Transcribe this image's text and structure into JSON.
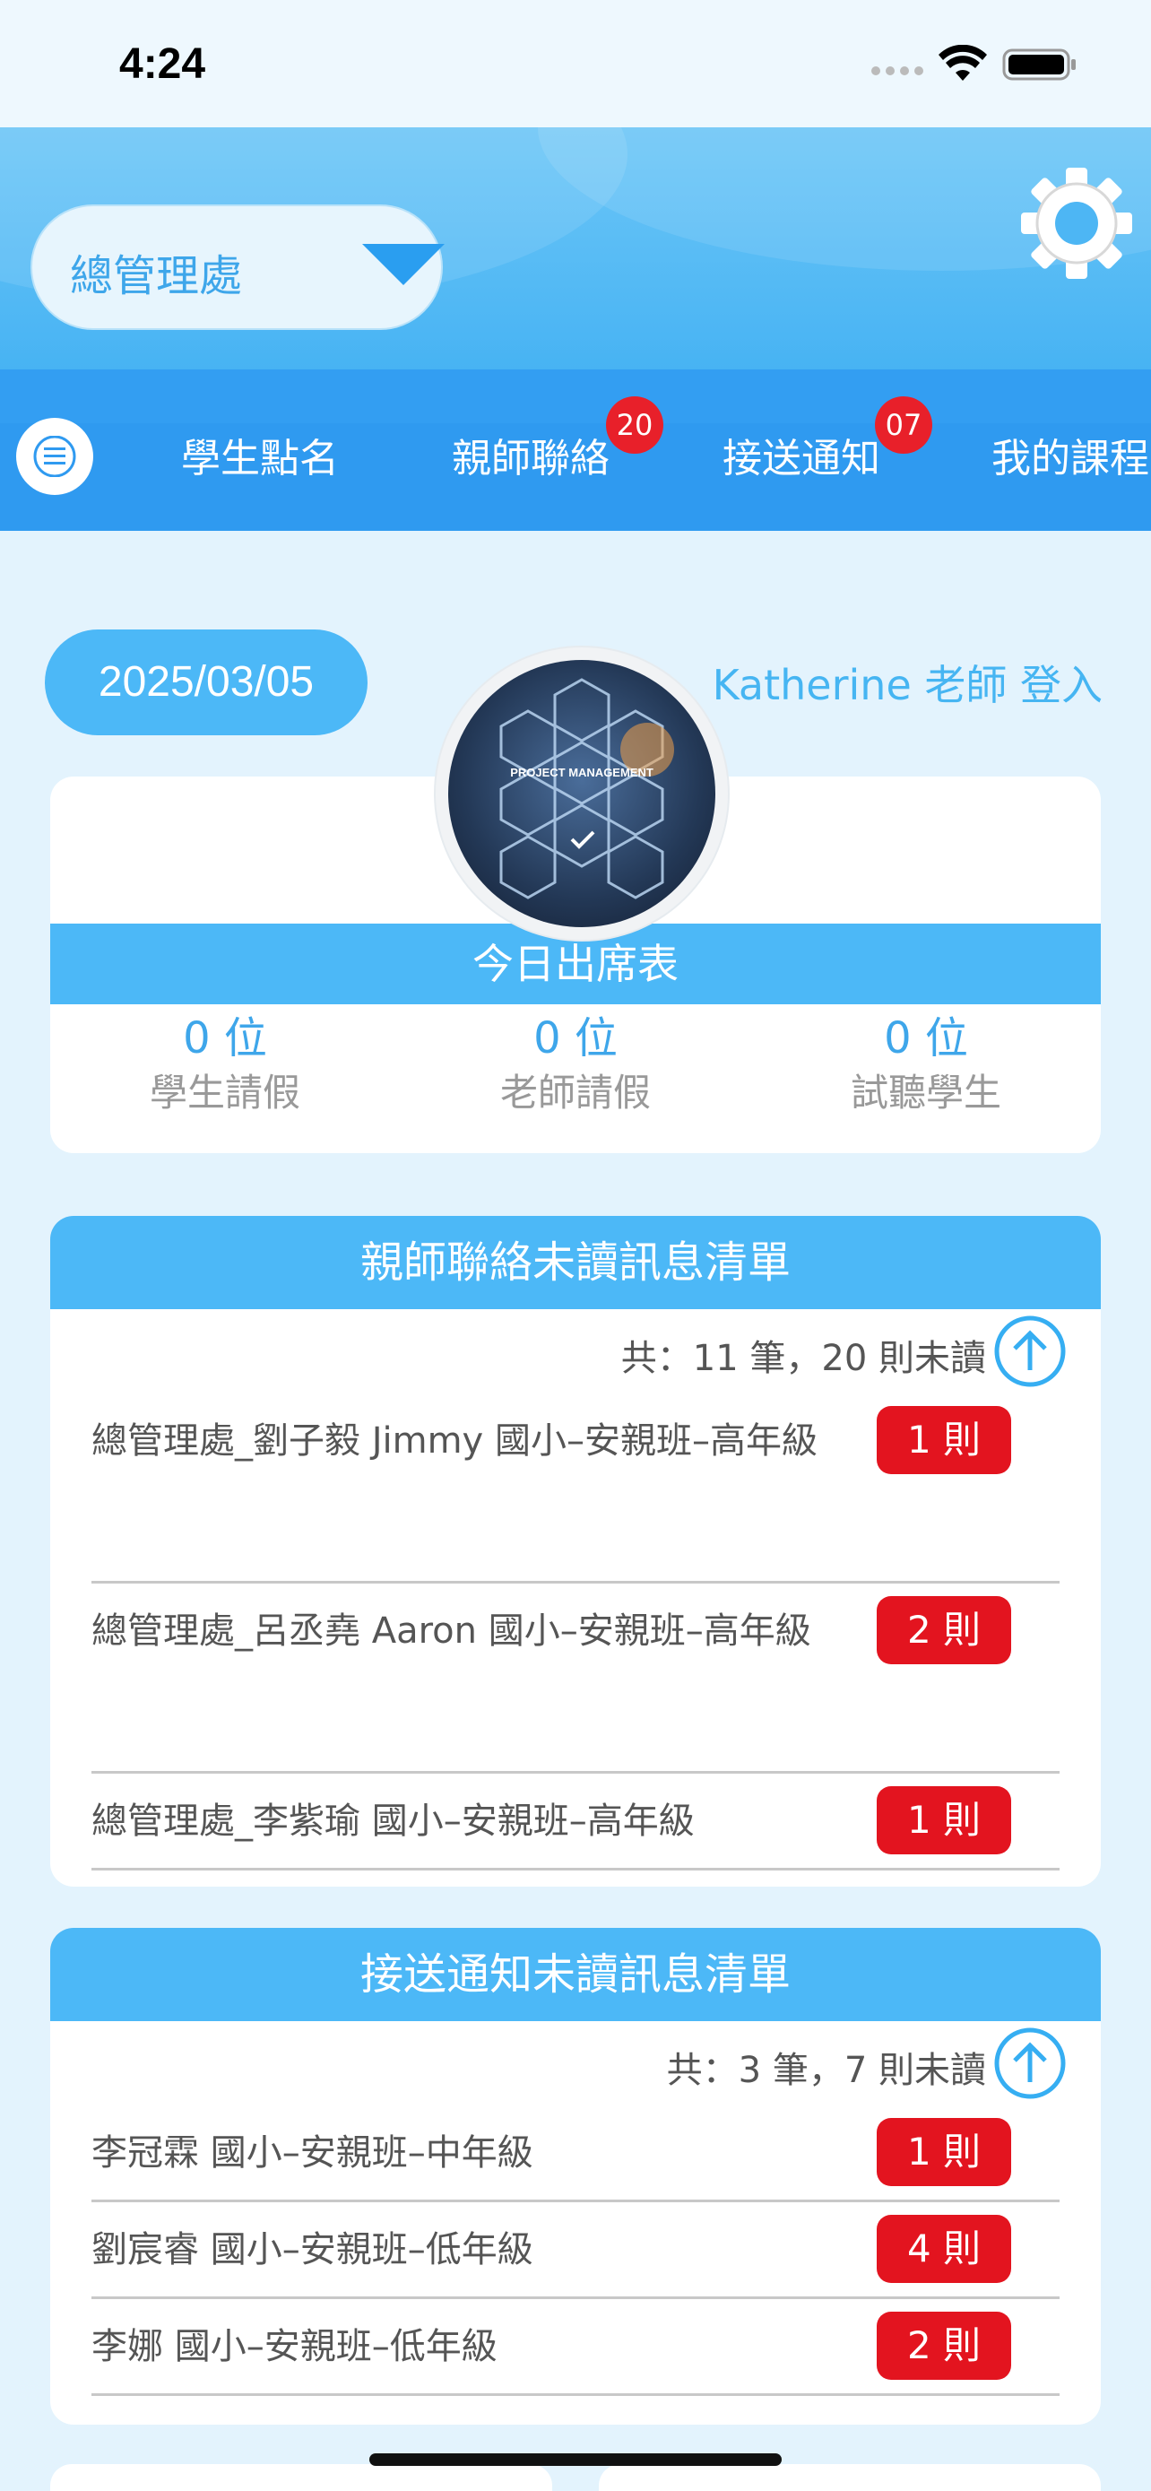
{
  "status_bar": {
    "time": "4:24"
  },
  "header": {
    "branch": "總管理處"
  },
  "nav": {
    "items": [
      {
        "label": "學生點名",
        "badge": ""
      },
      {
        "label": "親師聯絡",
        "badge": "20"
      },
      {
        "label": "接送通知",
        "badge": "07"
      },
      {
        "label": "我的課程",
        "badge": ""
      }
    ]
  },
  "attendance": {
    "date": "2025/03/05",
    "login": "Katherine 老師 登入",
    "logo_text": "PROJECT MANAGEMENT",
    "title": "今日出席表",
    "stats": [
      {
        "value": "0 位",
        "label": "學生請假"
      },
      {
        "value": "0 位",
        "label": "老師請假"
      },
      {
        "value": "0 位",
        "label": "試聽學生"
      }
    ]
  },
  "parent_teacher": {
    "title": "親師聯絡未讀訊息清單",
    "summary": "共：11 筆，20 則未讀",
    "rows": [
      {
        "text": "總管理處_劉子毅 Jimmy 國小–安親班–高年級",
        "count": "1 則"
      },
      {
        "text": "總管理處_呂丞堯 Aaron 國小–安親班–高年級",
        "count": "2 則"
      },
      {
        "text": "總管理處_李紫瑜 國小–安親班–高年級",
        "count": "1 則"
      }
    ]
  },
  "pickup": {
    "title": "接送通知未讀訊息清單",
    "summary": "共：3 筆，7 則未讀",
    "rows": [
      {
        "text": "李冠霖 國小–安親班–中年級",
        "count": "1 則"
      },
      {
        "text": "劉宸睿 國小–安親班–低年級",
        "count": "4 則"
      },
      {
        "text": "李娜 國小–安親班–低年級",
        "count": "2 則"
      }
    ]
  },
  "colors": {
    "primary": "#4cb8f7",
    "nav": "#2f9af0",
    "badge": "#e3141f",
    "background": "#e3f3fd"
  }
}
